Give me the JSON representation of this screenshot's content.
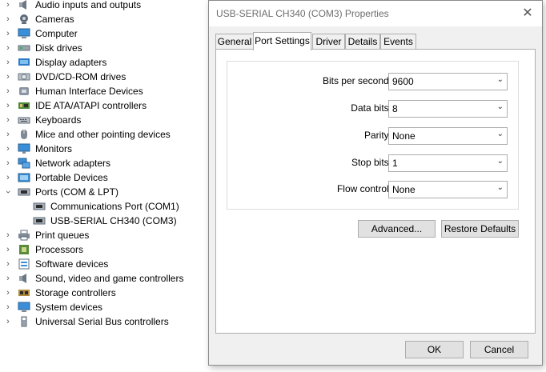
{
  "tree": {
    "categories": [
      {
        "label": "Audio inputs and outputs",
        "icon": "speaker-icon",
        "expanded": false
      },
      {
        "label": "Cameras",
        "icon": "camera-icon",
        "expanded": false
      },
      {
        "label": "Computer",
        "icon": "computer-icon",
        "expanded": false
      },
      {
        "label": "Disk drives",
        "icon": "disk-drive-icon",
        "expanded": false
      },
      {
        "label": "Display adapters",
        "icon": "display-adapter-icon",
        "expanded": false
      },
      {
        "label": "DVD/CD-ROM drives",
        "icon": "dvd-drive-icon",
        "expanded": false
      },
      {
        "label": "Human Interface Devices",
        "icon": "hid-icon",
        "expanded": false
      },
      {
        "label": "IDE ATA/ATAPI controllers",
        "icon": "ide-controller-icon",
        "expanded": false
      },
      {
        "label": "Keyboards",
        "icon": "keyboard-icon",
        "expanded": false
      },
      {
        "label": "Mice and other pointing devices",
        "icon": "mouse-icon",
        "expanded": false
      },
      {
        "label": "Monitors",
        "icon": "monitor-icon",
        "expanded": false
      },
      {
        "label": "Network adapters",
        "icon": "network-adapter-icon",
        "expanded": false
      },
      {
        "label": "Portable Devices",
        "icon": "portable-device-icon",
        "expanded": false
      },
      {
        "label": "Ports (COM & LPT)",
        "icon": "port-icon",
        "expanded": true
      },
      {
        "label": "Communications Port (COM1)",
        "icon": "port-icon",
        "child": true
      },
      {
        "label": "USB-SERIAL CH340 (COM3)",
        "icon": "port-icon",
        "child": true
      },
      {
        "label": "Print queues",
        "icon": "printer-icon",
        "expanded": false
      },
      {
        "label": "Processors",
        "icon": "processor-icon",
        "expanded": false
      },
      {
        "label": "Software devices",
        "icon": "software-device-icon",
        "expanded": false
      },
      {
        "label": "Sound, video and game controllers",
        "icon": "sound-icon",
        "expanded": false
      },
      {
        "label": "Storage controllers",
        "icon": "storage-controller-icon",
        "expanded": false
      },
      {
        "label": "System devices",
        "icon": "system-device-icon",
        "expanded": false
      },
      {
        "label": "Universal Serial Bus controllers",
        "icon": "usb-icon",
        "expanded": false
      }
    ]
  },
  "dialog": {
    "title": "USB-SERIAL CH340 (COM3) Properties",
    "close_glyph": "✕",
    "tabs": [
      {
        "label": "General",
        "active": false
      },
      {
        "label": "Port Settings",
        "active": true
      },
      {
        "label": "Driver",
        "active": false
      },
      {
        "label": "Details",
        "active": false
      },
      {
        "label": "Events",
        "active": false
      }
    ],
    "fields": [
      {
        "label": "Bits per second:",
        "value": "9600"
      },
      {
        "label": "Data bits:",
        "value": "8"
      },
      {
        "label": "Parity:",
        "value": "None"
      },
      {
        "label": "Stop bits:",
        "value": "1"
      },
      {
        "label": "Flow control:",
        "value": "None"
      }
    ],
    "advanced_label": "Advanced...",
    "restore_label": "Restore Defaults",
    "ok_label": "OK",
    "cancel_label": "Cancel"
  },
  "colors": {
    "accent": "#0078d7",
    "dialog_bg": "#f0f0f0",
    "button_bg": "#e1e1e1"
  }
}
